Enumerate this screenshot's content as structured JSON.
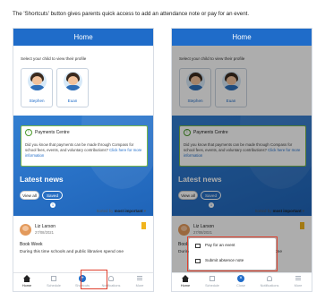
{
  "caption": "The 'Shortcuts' button gives parents quick access to add an attendance note or pay for an event.",
  "screens": [
    {
      "title": "Home",
      "select_text": "Select your child to view their profile",
      "children": [
        "Stephen",
        "Euan"
      ],
      "payments": {
        "title": "Payments Centre",
        "body": "Did you know that payments can be made through Compass for school fees, events, and voluntary contributions?",
        "link": "Click here for more information"
      },
      "latest_news": "Latest news",
      "view_all": "View all",
      "saved": "Saved",
      "saved_count": "1",
      "sorted_by": "Sorted by",
      "sort_value": "most important",
      "news_author": "Liz Larson",
      "news_date": "27/08/2021",
      "news_title": "Book Week",
      "news_body": "During this time schools and public libraries spend one",
      "tabs": [
        "Home",
        "Schedule",
        "Shortcuts",
        "Notifications",
        "More"
      ]
    },
    {
      "title": "Home",
      "select_text": "Select your child to view their profile",
      "children": [
        "Stephen",
        "Euan"
      ],
      "payments": {
        "title": "Payments Centre",
        "body": "Did you know that payments can be made through Compass for school fees, events, and voluntary contributions?",
        "link": "Click here for more information"
      },
      "latest_news": "Latest news",
      "view_all": "View all",
      "saved": "Saved",
      "saved_count": "1",
      "sorted_by": "Sorted by",
      "sort_value": "most important",
      "news_author": "Liz Larson",
      "news_date": "27/08/2021",
      "news_title": "Book Week",
      "news_body": "During this time schools and public libraries spend one",
      "tabs": [
        "Home",
        "Schedule",
        "Close",
        "Notifications",
        "More"
      ],
      "popup_items": [
        "Pay for an event",
        "Submit absence note"
      ]
    }
  ],
  "colors": {
    "brand": "#1f6cc9",
    "highlight": "#e0402e",
    "payments_border": "#79b84a",
    "bookmark": "#f1b41d"
  }
}
